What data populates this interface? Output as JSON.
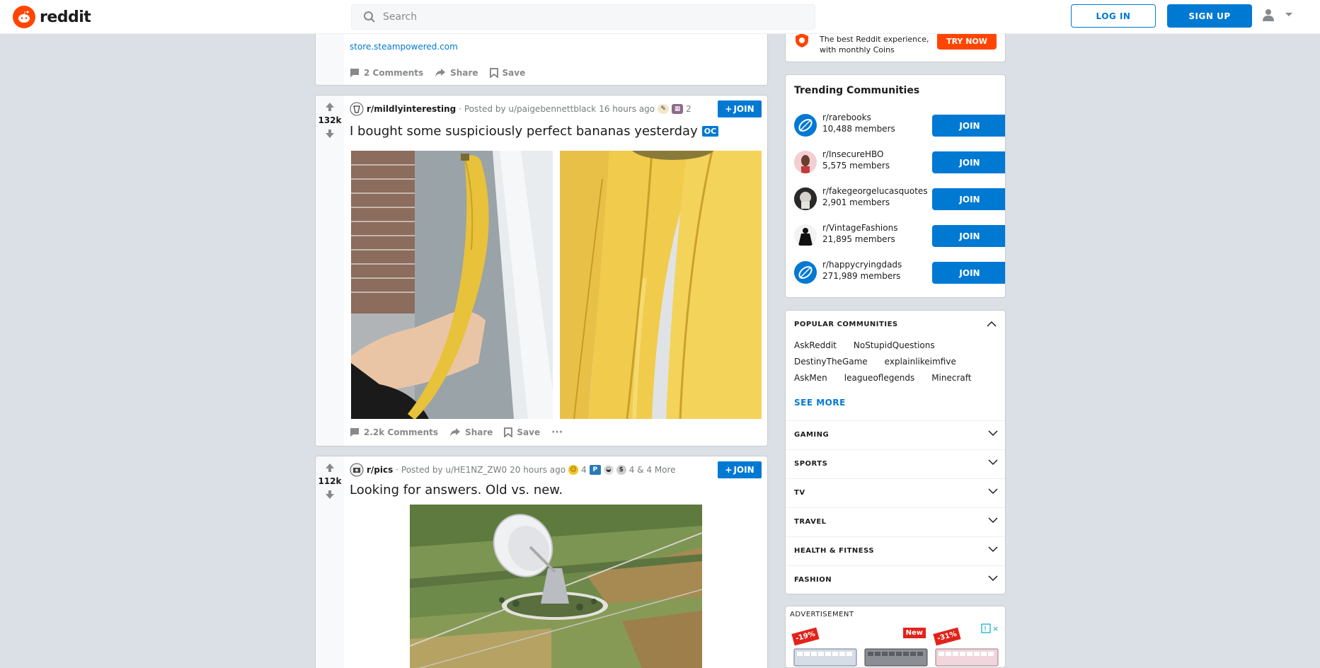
{
  "header": {
    "logo_text": "reddit",
    "search_placeholder": "Search",
    "login_label": "LOG IN",
    "signup_label": "SIGN UP"
  },
  "prev_post": {
    "link": "store.steampowered.com",
    "comments": "2 Comments",
    "share": "Share",
    "save": "Save"
  },
  "post1": {
    "votes": "132k",
    "subreddit": "r/mildlyinteresting",
    "posted_by": "· Posted by u/paigebennettblack",
    "time": "16 hours ago",
    "award_count": "2",
    "join": "JOIN",
    "title": "I bought some suspiciously perfect bananas yesterday",
    "flair": "OC",
    "comments": "2.2k Comments",
    "share": "Share",
    "save": "Save",
    "more": "···"
  },
  "post2": {
    "votes": "112k",
    "subreddit": "r/pics",
    "posted_by": "· Posted by u/HE1NZ_ZW0",
    "time": "20 hours ago",
    "award_count_1": "4",
    "award_p": "P",
    "award_more": "4 & 4 More",
    "join": "JOIN",
    "title": "Looking for answers. Old vs. new."
  },
  "premium": {
    "text_line1": "The best Reddit experience,",
    "text_line2": "with monthly Coins",
    "button": "TRY NOW"
  },
  "trending": {
    "title": "Trending Communities",
    "join": "JOIN",
    "items": [
      {
        "name": "r/rarebooks",
        "members": "10,488 members"
      },
      {
        "name": "r/InsecureHBO",
        "members": "5,575 members"
      },
      {
        "name": "r/fakegeorgelucasquotes",
        "members": "2,901 members"
      },
      {
        "name": "r/VintageFashions",
        "members": "21,895 members"
      },
      {
        "name": "r/happycryingdads",
        "members": "271,989 members"
      }
    ]
  },
  "popular": {
    "title": "POPULAR COMMUNITIES",
    "links": [
      "AskReddit",
      "NoStupidQuestions",
      "DestinyTheGame",
      "explainlikeimfive",
      "AskMen",
      "leagueoflegends",
      "Minecraft"
    ],
    "see_more": "SEE MORE",
    "categories": [
      "GAMING",
      "SPORTS",
      "TV",
      "TRAVEL",
      "HEALTH & FITNESS",
      "FASHION"
    ]
  },
  "ad": {
    "label": "ADVERTISEMENT",
    "badge1": "-19%",
    "badge2": "New",
    "badge3": "-31%"
  }
}
